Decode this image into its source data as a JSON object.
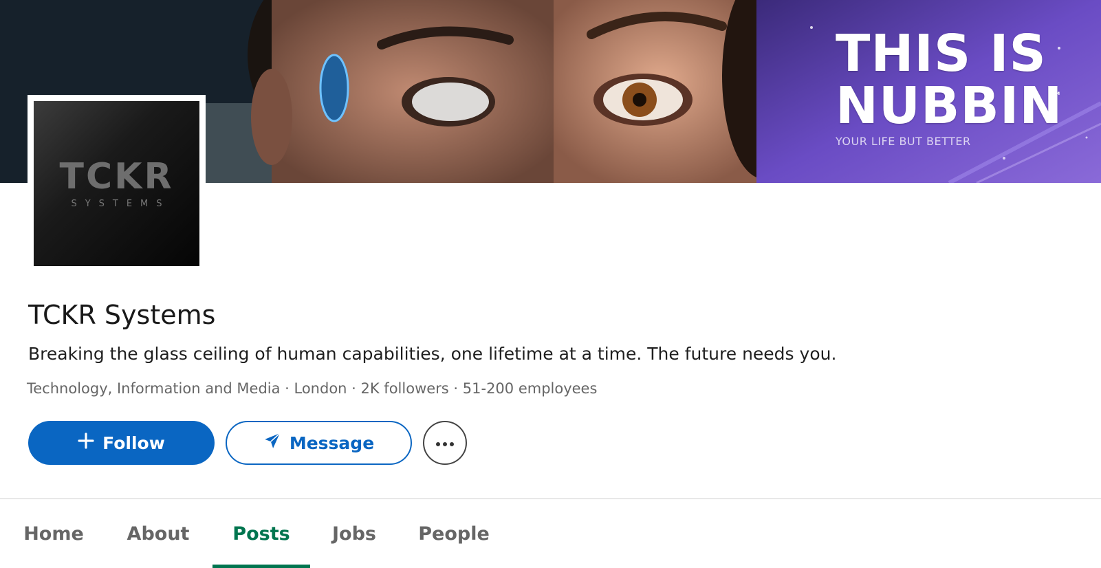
{
  "cover": {
    "headline": "THIS IS\nNUBBIN",
    "trademark": "™",
    "subline": "YOUR LIFE BUT BETTER"
  },
  "logo": {
    "word": "TCKR",
    "sub": "SYSTEMS"
  },
  "company": {
    "name": "TCKR Systems",
    "tagline": "Breaking the glass ceiling of human capabilities, one lifetime at a time. The future needs you.",
    "meta": "Technology, Information and Media · London · 2K followers · 51-200 employees"
  },
  "actions": {
    "follow_label": "Follow",
    "message_label": "Message",
    "more_label": "···"
  },
  "tabs": [
    {
      "label": "Home",
      "active": false
    },
    {
      "label": "About",
      "active": false
    },
    {
      "label": "Posts",
      "active": true
    },
    {
      "label": "Jobs",
      "active": false
    },
    {
      "label": "People",
      "active": false
    }
  ],
  "colors": {
    "primary": "#0a66c2",
    "active_tab": "#01754f",
    "muted_text": "#666666"
  }
}
